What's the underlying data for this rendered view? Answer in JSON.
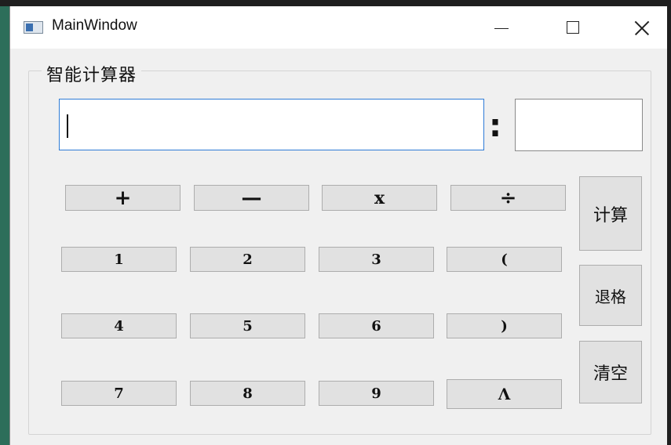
{
  "window": {
    "title": "MainWindow",
    "controls": {
      "minimize": "—",
      "maximize": "☐",
      "close": "✕"
    }
  },
  "group": {
    "title": "智能计算器"
  },
  "expression_input": {
    "value": "",
    "placeholder": ""
  },
  "separator": ":",
  "result": {
    "value": ""
  },
  "operators": [
    {
      "label": "+"
    },
    {
      "label": "—"
    },
    {
      "label": "x"
    },
    {
      "label": "÷"
    }
  ],
  "keys": {
    "row1": [
      "1",
      "2",
      "3",
      "("
    ],
    "row2": [
      "4",
      "5",
      "6",
      ")"
    ],
    "row3": [
      "7",
      "8",
      "9",
      "Λ"
    ]
  },
  "side_buttons": {
    "calculate": "计算",
    "backspace": "退格",
    "clear": "清空"
  },
  "colors": {
    "input_focus_border": "#2e7bd6",
    "button_bg": "#e1e1e1",
    "window_bg": "#f0f0f0"
  }
}
